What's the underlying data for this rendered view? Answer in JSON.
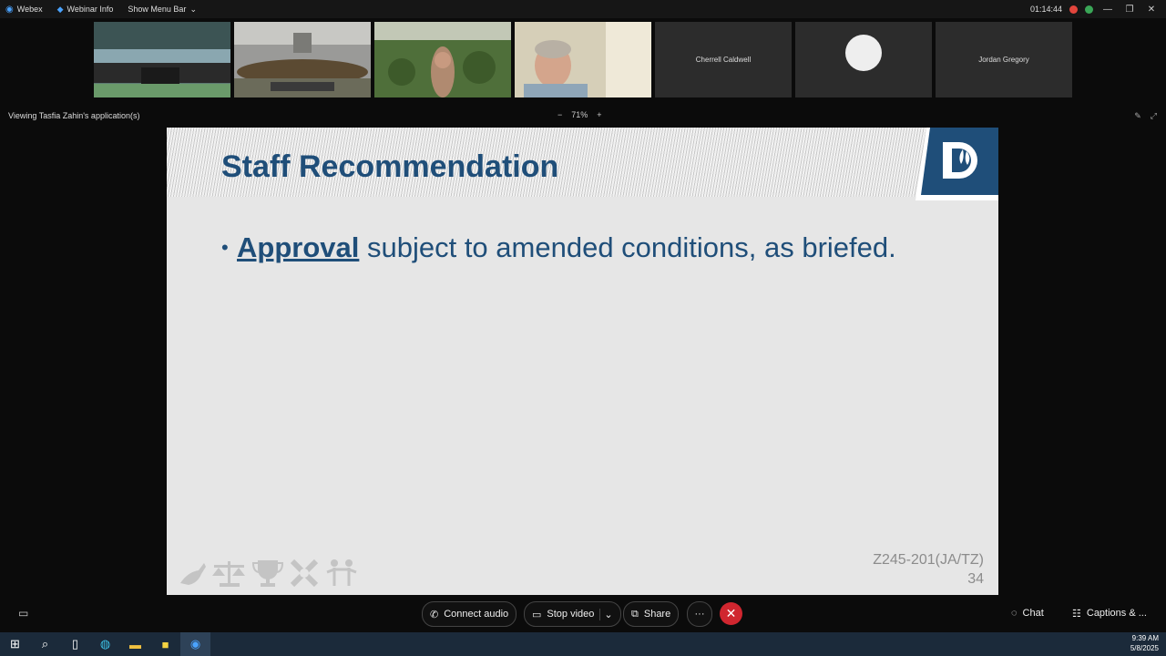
{
  "titlebar": {
    "app_name": "Webex",
    "webinar_info": "Webinar Info",
    "show_menu_bar": "Show Menu Bar",
    "timer": "01:14:44"
  },
  "participants": [
    {
      "name": ""
    },
    {
      "name": ""
    },
    {
      "name": ""
    },
    {
      "name": ""
    },
    {
      "name": "Cherrell Caldwell"
    },
    {
      "name": ""
    },
    {
      "name": "Jordan Gregory"
    }
  ],
  "share_bar": {
    "viewing_label": "Viewing Tasfia Zahin's application(s)",
    "zoom_minus": "−",
    "zoom_level": "71%",
    "zoom_plus": "+"
  },
  "slide": {
    "title": "Staff Recommendation",
    "bullet_bold": "Approval",
    "bullet_rest": "subject to amended conditions, as briefed.",
    "case_number": "Z245-201(JA/TZ)",
    "page_number": "34"
  },
  "controls": {
    "connect_audio": "Connect audio",
    "stop_video": "Stop video",
    "share": "Share",
    "more": "···",
    "chat": "Chat",
    "captions": "Captions & ..."
  },
  "taskbar": {
    "time": "9:39 AM",
    "date": "5/8/2025"
  },
  "colors": {
    "slide_title": "#1f4e79",
    "end_call": "#d0262f",
    "taskbar": "#1b2a3a"
  }
}
